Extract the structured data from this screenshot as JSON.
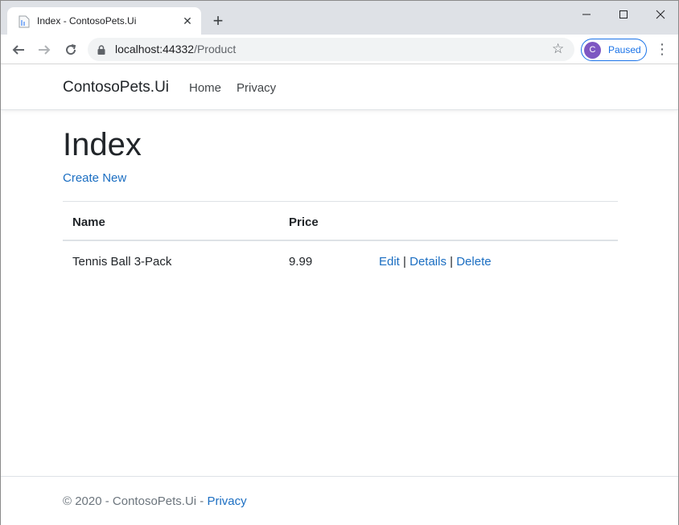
{
  "browser": {
    "tab_title": "Index - ContosoPets.Ui",
    "tab_close_glyph": "✕",
    "newtab_glyph": "+",
    "url_host": "localhost:44332",
    "url_path": "/Product",
    "profile_initial": "C",
    "profile_status": "Paused",
    "accent_color": "#1a73e8",
    "avatar_color": "#7e57c2"
  },
  "site": {
    "brand": "ContosoPets.Ui",
    "nav": {
      "home": "Home",
      "privacy": "Privacy"
    },
    "link_color": "#1b6ec2"
  },
  "page": {
    "title": "Index",
    "create_new": "Create New",
    "table": {
      "headers": {
        "name": "Name",
        "price": "Price"
      },
      "rows": [
        {
          "name": "Tennis Ball 3-Pack",
          "price": "9.99",
          "edit": "Edit",
          "details": "Details",
          "delete": "Delete"
        }
      ],
      "separator": "|"
    }
  },
  "footer": {
    "text": "© 2020 - ContosoPets.Ui - ",
    "privacy": "Privacy"
  }
}
